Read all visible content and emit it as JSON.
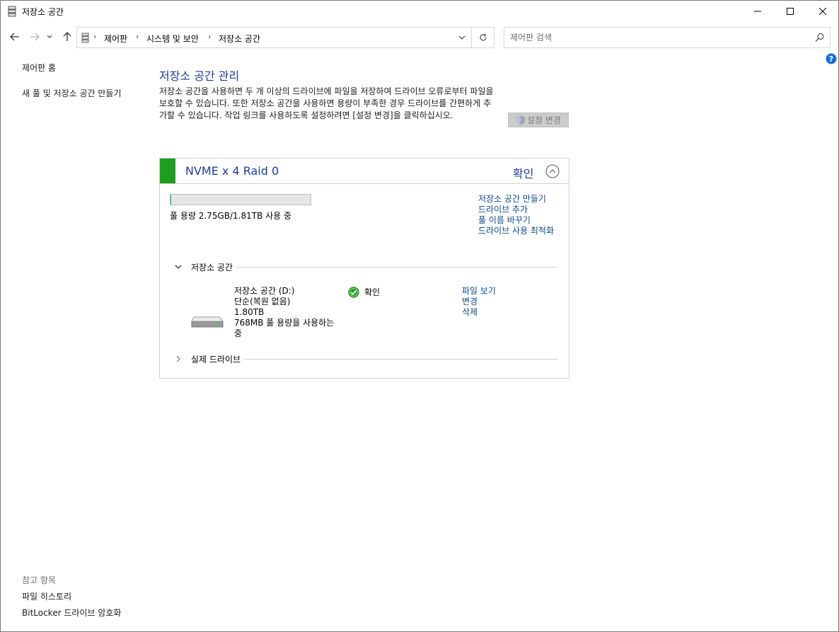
{
  "window": {
    "title": "저장소 공간"
  },
  "nav": {
    "breadcrumbs": [
      "제어판",
      "시스템 및 보안",
      "저장소 공간"
    ],
    "search_placeholder": "제어판 검색"
  },
  "sidebar": {
    "items": [
      {
        "label": "제어판 홈"
      },
      {
        "label": "새 풀 및 저장소 공간 만들기"
      }
    ],
    "see_also_title": "참고 항목",
    "see_also": [
      {
        "label": "파일 히스토리"
      },
      {
        "label": "BitLocker 드라이브 암호화"
      }
    ]
  },
  "main": {
    "title": "저장소 공간 관리",
    "description": "저장소 공간을 사용하면 두 개 이상의 드라이브에 파일을 저장하여 드라이브 오류로부터 파일을 보호할 수 있습니다. 또한 저장소 공간을 사용하면 용량이 부족한 경우 드라이브를 간편하게 추가할 수 있습니다. 작업 링크를 사용하도록 설정하려면 [설정 변경]을 클릭하십시오.",
    "change_settings_label": "설정 변경"
  },
  "pool": {
    "name": "NVME x 4 Raid 0",
    "status": "확인",
    "usage_fraction": 0.0015,
    "usage_text": "풀 용량 2.75GB/1.81TB 사용 중",
    "links": [
      "저장소 공간 만들기",
      "드라이브 추가",
      "풀 이름 바꾸기",
      "드라이브 사용 최적화"
    ],
    "spaces_section": "저장소 공간",
    "drives_section": "실제 드라이브",
    "space": {
      "name": "저장소 공간 (D:)",
      "resiliency": "단순(복원 없음)",
      "capacity": "1.80TB",
      "usage": "768MB 풀 용량을 사용하는 중",
      "status": "확인",
      "links": [
        "파일 보기",
        "변경",
        "삭제"
      ]
    }
  },
  "colors": {
    "link": "#0a4a8c",
    "heading": "#1e3c96",
    "pool_ok": "#1e9d1e"
  }
}
